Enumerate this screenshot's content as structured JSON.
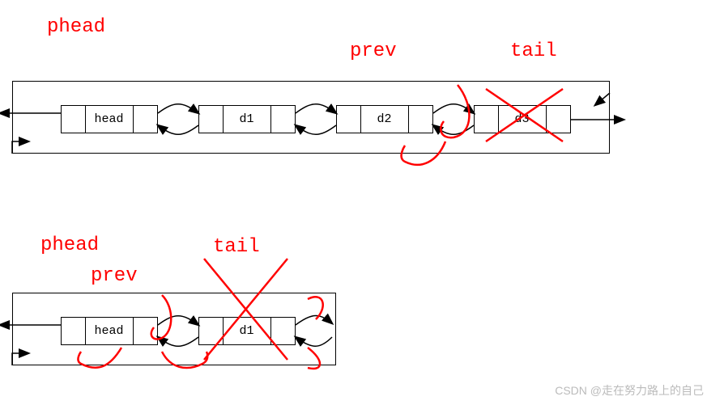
{
  "labels": {
    "phead1": "phead",
    "prev1": "prev",
    "tail1": "tail",
    "phead2": "phead",
    "prev2": "prev",
    "tail2": "tail"
  },
  "diagram1": {
    "nodes": [
      {
        "text": "head"
      },
      {
        "text": "d1"
      },
      {
        "text": "d2"
      },
      {
        "text": "d3"
      }
    ]
  },
  "diagram2": {
    "nodes": [
      {
        "text": "head"
      },
      {
        "text": "d1"
      }
    ]
  },
  "watermark": "CSDN @走在努力路上的自己"
}
